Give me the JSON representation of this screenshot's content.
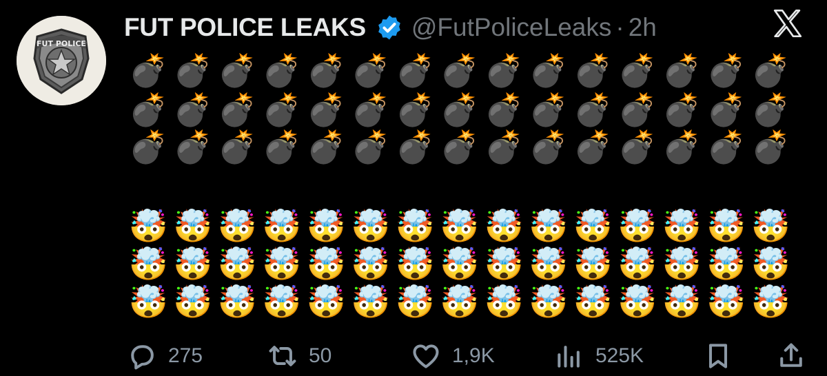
{
  "tweet": {
    "display_name": "FUT POLICE LEAKS",
    "handle": "@FutPoliceLeaks",
    "separator": "·",
    "time": "2h",
    "avatar_text": "FUT POLICE",
    "body_line_groups": [
      {
        "emoji": "💣",
        "rows": 3,
        "per_row": 15
      },
      {
        "emoji": "🤯",
        "rows": 3,
        "per_row": 15
      }
    ],
    "bomb_row_text": "💣💣💣💣💣💣💣💣💣💣💣💣💣💣💣",
    "head_row_text": "🤯🤯🤯🤯🤯🤯🤯🤯🤯🤯🤯🤯🤯🤯🤯"
  },
  "actions": {
    "replies": "275",
    "reposts": "50",
    "likes": "1,9K",
    "views": "525K"
  },
  "colors": {
    "background": "#000000",
    "verified_badge": "#1d9bf0",
    "muted_text": "#71767b"
  },
  "icons": [
    "reply-icon",
    "repost-icon",
    "like-icon",
    "views-icon",
    "bookmark-icon",
    "share-icon",
    "x-logo-icon",
    "verified-badge-icon"
  ]
}
